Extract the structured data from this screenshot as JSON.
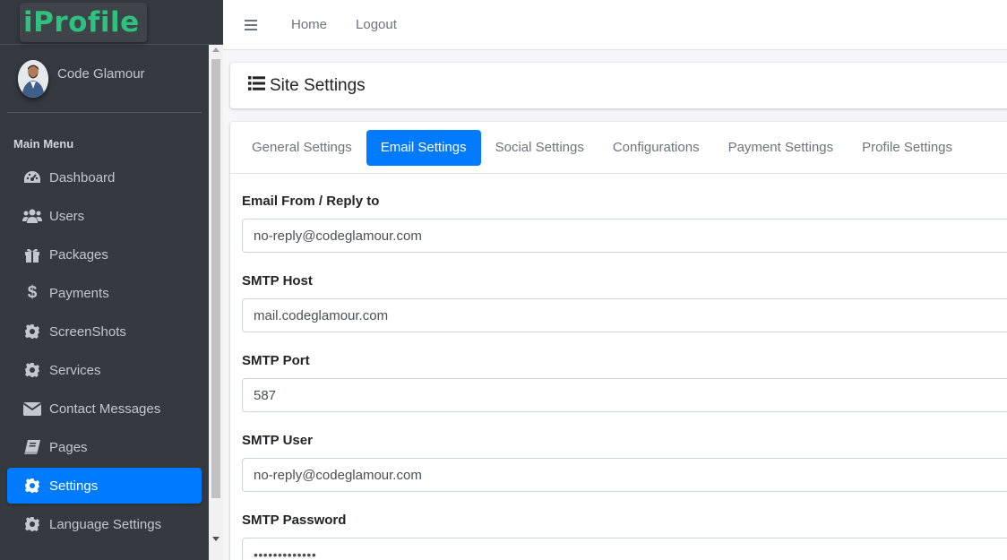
{
  "brand": {
    "name": "iProfile"
  },
  "user": {
    "name": "Code Glamour"
  },
  "sidebar": {
    "header": "Main Menu",
    "items": [
      {
        "label": "Dashboard",
        "icon": "dashboard-icon"
      },
      {
        "label": "Users",
        "icon": "users-icon"
      },
      {
        "label": "Packages",
        "icon": "gift-icon"
      },
      {
        "label": "Payments",
        "icon": "dollar-icon"
      },
      {
        "label": "ScreenShots",
        "icon": "gear-icon"
      },
      {
        "label": "Services",
        "icon": "gear-icon"
      },
      {
        "label": "Contact Messages",
        "icon": "envelope-icon"
      },
      {
        "label": "Pages",
        "icon": "book-icon"
      },
      {
        "label": "Settings",
        "icon": "gear-icon",
        "active": true
      },
      {
        "label": "Language Settings",
        "icon": "gear-icon"
      }
    ]
  },
  "topbar": {
    "home": "Home",
    "logout": "Logout"
  },
  "page": {
    "title": "Site Settings"
  },
  "tabs": [
    {
      "label": "General Settings"
    },
    {
      "label": "Email Settings",
      "active": true
    },
    {
      "label": "Social Settings"
    },
    {
      "label": "Configurations"
    },
    {
      "label": "Payment Settings"
    },
    {
      "label": "Profile Settings"
    }
  ],
  "form": {
    "email_from": {
      "label": "Email From / Reply to",
      "value": "no-reply@codeglamour.com"
    },
    "smtp_host": {
      "label": "SMTP Host",
      "value": "mail.codeglamour.com"
    },
    "smtp_port": {
      "label": "SMTP Port",
      "value": "587"
    },
    "smtp_user": {
      "label": "SMTP User",
      "value": "no-reply@codeglamour.com"
    },
    "smtp_password": {
      "label": "SMTP Password",
      "value": "•••••••••••••"
    }
  },
  "colors": {
    "sidebar": "#343a40",
    "accent": "#007bff",
    "brand": "#2ec27e"
  }
}
